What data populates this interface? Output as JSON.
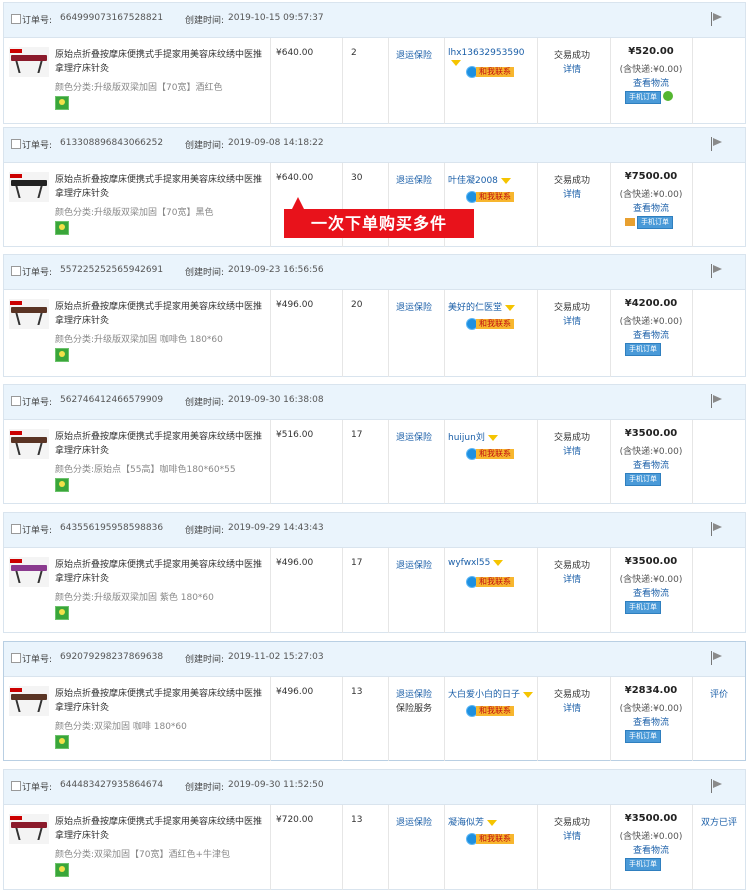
{
  "labels": {
    "order_no": "订单号:",
    "created": "创建时间:",
    "spec_prefix": "颜色分类:",
    "insurance": "退运保险",
    "contact": "和我联系",
    "status": "交易成功",
    "detail": "详情",
    "logistics": "查看物流",
    "mobile_order": "手机订单"
  },
  "banner": "一次下单购买多件",
  "orders": [
    {
      "order_no": "664999073167528821",
      "created": "2019-10-15 09:57:37",
      "title": "原始点折叠按摩床便携式手提家用美容床纹绣中医推拿理疗床针灸",
      "spec": "颜色分类:升级版双梁加固【70宽】酒红色",
      "price": "¥640.00",
      "qty": "2",
      "insurance": "退运保险",
      "insurance2": "",
      "buyer": "lhx13632953590",
      "status": "交易成功",
      "detail": "详情",
      "total": "¥520.00",
      "ship": "(含快递:¥0.00)",
      "logistics": "查看物流",
      "mobile": "手机订单",
      "extra": "",
      "color": "#8b1a2b"
    },
    {
      "order_no": "613308896843066252",
      "created": "2019-09-08 14:18:22",
      "title": "原始点折叠按摩床便携式手提家用美容床纹绣中医推拿理疗床针灸",
      "spec": "颜色分类:升级版双梁加固【70宽】黑色",
      "price": "¥640.00",
      "qty": "30",
      "insurance": "退运保险",
      "insurance2": "",
      "buyer": "叶佳凝2008",
      "status": "交易成功",
      "detail": "详情",
      "total": "¥7500.00",
      "ship": "(含快递:¥0.00)",
      "logistics": "查看物流",
      "mobile": "手机订单",
      "extra": "",
      "color": "#222222"
    },
    {
      "order_no": "557225252565942691",
      "created": "2019-09-23 16:56:56",
      "title": "原始点折叠按摩床便携式手提家用美容床纹绣中医推拿理疗床针灸",
      "spec": "颜色分类:升级版双梁加固 咖啡色 180*60",
      "price": "¥496.00",
      "qty": "20",
      "insurance": "退运保险",
      "insurance2": "",
      "buyer": "美好的仁医堂",
      "status": "交易成功",
      "detail": "详情",
      "total": "¥4200.00",
      "ship": "(含快递:¥0.00)",
      "logistics": "查看物流",
      "mobile": "手机订单",
      "extra": "",
      "color": "#5a3424"
    },
    {
      "order_no": "562746412466579909",
      "created": "2019-09-30 16:38:08",
      "title": "原始点折叠按摩床便携式手提家用美容床纹绣中医推拿理疗床针灸",
      "spec": "颜色分类:原始点【55高】咖啡色180*60*55",
      "price": "¥516.00",
      "qty": "17",
      "insurance": "退运保险",
      "insurance2": "",
      "buyer": "huijun刘",
      "status": "交易成功",
      "detail": "详情",
      "total": "¥3500.00",
      "ship": "(含快递:¥0.00)",
      "logistics": "查看物流",
      "mobile": "手机订单",
      "extra": "",
      "color": "#5a3424"
    },
    {
      "order_no": "643556195958598836",
      "created": "2019-09-29 14:43:43",
      "title": "原始点折叠按摩床便携式手提家用美容床纹绣中医推拿理疗床针灸",
      "spec": "颜色分类:升级版双梁加固 紫色 180*60",
      "price": "¥496.00",
      "qty": "17",
      "insurance": "退运保险",
      "insurance2": "",
      "buyer": "wyfwxl55",
      "status": "交易成功",
      "detail": "详情",
      "total": "¥3500.00",
      "ship": "(含快递:¥0.00)",
      "logistics": "查看物流",
      "mobile": "手机订单",
      "extra": "",
      "color": "#8a3a8e"
    },
    {
      "order_no": "692079298237869638",
      "created": "2019-11-02 15:27:03",
      "title": "原始点折叠按摩床便携式手提家用美容床纹绣中医推拿理疗床针灸",
      "spec": "颜色分类:双梁加固 咖啡 180*60",
      "price": "¥496.00",
      "qty": "13",
      "insurance": "退运保险",
      "insurance2": "保险服务",
      "buyer": "大白爱小白的日子",
      "status": "交易成功",
      "detail": "详情",
      "total": "¥2834.00",
      "ship": "(含快递:¥0.00)",
      "logistics": "查看物流",
      "mobile": "手机订单",
      "extra": "评价",
      "color": "#5a3424"
    },
    {
      "order_no": "644483427935864674",
      "created": "2019-09-30 11:52:50",
      "title": "原始点折叠按摩床便携式手提家用美容床纹绣中医推拿理疗床针灸",
      "spec": "颜色分类:双梁加固【70宽】酒红色+牛津包",
      "price": "¥720.00",
      "qty": "13",
      "insurance": "退运保险",
      "insurance2": "",
      "buyer": "凝海似芳",
      "status": "交易成功",
      "detail": "详情",
      "total": "¥3500.00",
      "ship": "(含快递:¥0.00)",
      "logistics": "查看物流",
      "mobile": "手机订单",
      "extra": "双方已评",
      "color": "#8b1a2b"
    }
  ]
}
